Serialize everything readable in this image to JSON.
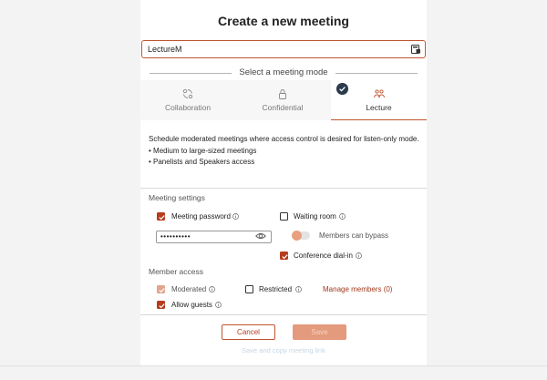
{
  "dialog": {
    "title": "Create a new meeting",
    "meeting_name_value": "LectureM",
    "mode_section_label": "Select a meeting mode"
  },
  "modes": [
    {
      "label": "Collaboration",
      "icon": "collaboration-icon",
      "selected": false
    },
    {
      "label": "Confidential",
      "icon": "lock-icon",
      "selected": false
    },
    {
      "label": "Lecture",
      "icon": "people-icon",
      "selected": true
    }
  ],
  "description": {
    "text": "Schedule moderated meetings where access control is desired for listen-only mode.",
    "bullets": [
      "• Medium to large-sized meetings",
      "• Panelists and Speakers access"
    ]
  },
  "meeting_settings": {
    "label": "Meeting settings",
    "meeting_password": {
      "label": "Meeting password",
      "checked": true
    },
    "password_mask": "••••••••••",
    "waiting_room": {
      "label": "Waiting room",
      "checked": false
    },
    "members_can_bypass": {
      "label": "Members can bypass",
      "on": false
    },
    "conference_dial_in": {
      "label": "Conference dial-in",
      "checked": true
    }
  },
  "member_access": {
    "label": "Member access",
    "moderated": {
      "label": "Moderated",
      "checked": true,
      "disabled": true
    },
    "restricted": {
      "label": "Restricted",
      "checked": false
    },
    "manage_members": "Manage members (0)",
    "allow_guests": {
      "label": "Allow guests",
      "checked": true
    }
  },
  "footer": {
    "cancel_label": "Cancel",
    "primary_label": "Save",
    "save_copy_link": "Save and copy meeting link"
  },
  "colors": {
    "accent": "#b53c1c",
    "accent_light": "#e49a7c",
    "badge": "#2c3a4e",
    "link_disabled": "#c5d6e6"
  }
}
